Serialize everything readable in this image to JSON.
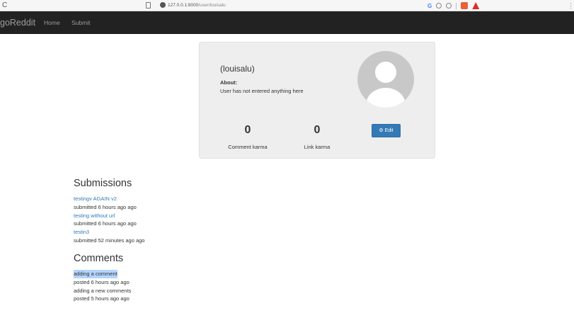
{
  "browser": {
    "url_host": "127.0.0.1:8000",
    "url_path": "/user/louisalu"
  },
  "navbar": {
    "brand": "goReddit",
    "links": [
      "Home",
      "Submit"
    ]
  },
  "profile": {
    "username": "(louisalu)",
    "about_label": "About:",
    "about_text": "User has not entered anything here",
    "comment_karma": "0",
    "comment_karma_label": "Comment karma",
    "link_karma": "0",
    "link_karma_label": "Link karma",
    "edit_label": "Edit"
  },
  "submissions": {
    "title": "Submissions",
    "items": [
      {
        "title": "testingv AGAIN v2",
        "meta": "submitted 6 hours ago ago"
      },
      {
        "title": "testing without url",
        "meta": "submitted 6 hours ago ago"
      },
      {
        "title": "testin3",
        "meta": "submitted 52 minutes ago ago"
      }
    ]
  },
  "comments": {
    "title": "Comments",
    "items": [
      {
        "text": "adding a comment",
        "meta": "posted 6 hours ago ago",
        "selected": true
      },
      {
        "text": "adding a new comments",
        "meta": "posted 5 hours ago ago",
        "selected": false
      }
    ]
  },
  "colors": {
    "navbar_bg": "#222222",
    "card_bg": "#eeeeee",
    "link": "#337ab7",
    "button": "#337ab7",
    "selection": "#b3d4fc"
  }
}
